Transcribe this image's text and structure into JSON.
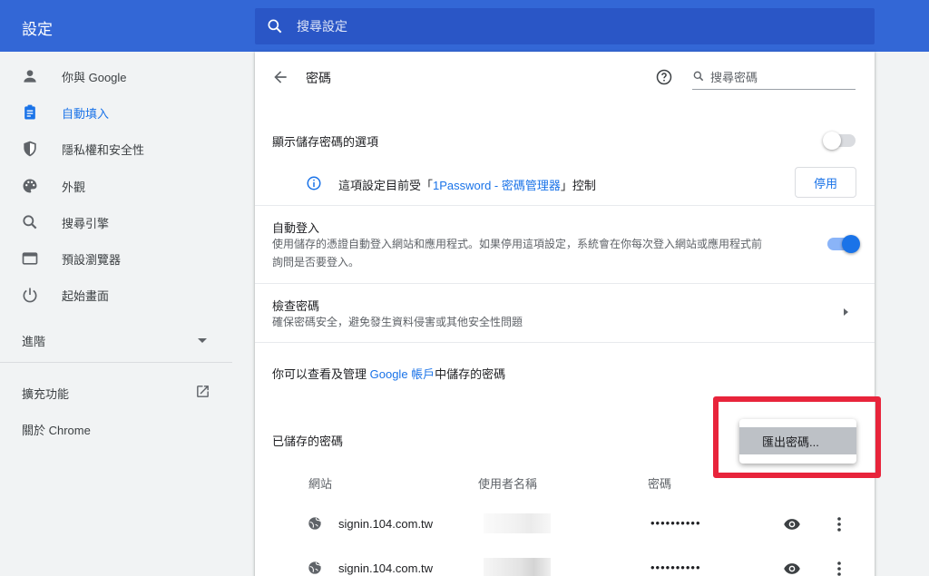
{
  "header": {
    "title": "設定",
    "search_placeholder": "搜尋設定"
  },
  "sidebar": {
    "items": [
      {
        "label": "你與 Google",
        "icon": "person-icon"
      },
      {
        "label": "自動填入",
        "icon": "clipboard-icon",
        "active": true
      },
      {
        "label": "隱私權和安全性",
        "icon": "shield-icon"
      },
      {
        "label": "外觀",
        "icon": "palette-icon"
      },
      {
        "label": "搜尋引擎",
        "icon": "search-icon"
      },
      {
        "label": "預設瀏覽器",
        "icon": "browser-icon"
      },
      {
        "label": "起始畫面",
        "icon": "power-icon"
      }
    ],
    "advanced": "進階",
    "extensions": "擴充功能",
    "about": "關於 Chrome"
  },
  "passwords": {
    "title": "密碼",
    "search_placeholder": "搜尋密碼",
    "offer_to_save": {
      "label": "顯示儲存密碼的選項",
      "enabled": false
    },
    "policy": {
      "prefix": "這項設定目前受「",
      "extension_name": "1Password - 密碼管理器",
      "suffix": "」控制",
      "button": "停用"
    },
    "auto_signin": {
      "label": "自動登入",
      "desc_line1": "使用儲存的憑證自動登入網站和應用程式。如果停用這項設定，系統會在你每次登入網站或應用程式前",
      "desc_line2": "詢問是否要登入。",
      "enabled": true
    },
    "check": {
      "label": "檢查密碼",
      "desc": "確保密碼安全，避免發生資料侵害或其他安全性問題"
    },
    "account_note": {
      "prefix": "你可以查看及管理 ",
      "link": "Google 帳戶",
      "suffix": "中儲存的密碼"
    },
    "saved_title": "已儲存的密碼",
    "columns": {
      "site": "網站",
      "username": "使用者名稱",
      "password": "密碼"
    },
    "rows": [
      {
        "site": "signin.104.com.tw",
        "password": "••••••••••"
      },
      {
        "site": "signin.104.com.tw",
        "password": "••••••••••"
      }
    ],
    "menu": {
      "export": "匯出密碼..."
    }
  },
  "colors": {
    "accent": "#1a73e8",
    "topbar": "#3367d6",
    "highlight": "#e8243b"
  }
}
